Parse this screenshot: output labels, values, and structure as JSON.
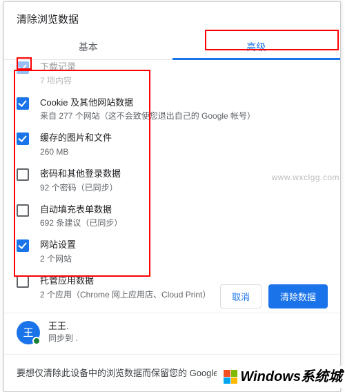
{
  "dialog": {
    "title": "清除浏览数据"
  },
  "tabs": {
    "basic": "基本",
    "advanced": "高级"
  },
  "topItem": {
    "title": "下载记录",
    "sub": "7 项内容"
  },
  "items": [
    {
      "checked": true,
      "title": "Cookie 及其他网站数据",
      "sub": "来自 277 个网站（这不会致使您退出自己的 Google 帐号）"
    },
    {
      "checked": true,
      "title": "缓存的图片和文件",
      "sub": "260 MB"
    },
    {
      "checked": false,
      "title": "密码和其他登录数据",
      "sub": "92 个密码（已同步）"
    },
    {
      "checked": false,
      "title": "自动填充表单数据",
      "sub": "692 条建议（已同步）"
    },
    {
      "checked": true,
      "title": "网站设置",
      "sub": "2 个网站"
    },
    {
      "checked": false,
      "title": "托管应用数据",
      "sub": "2 个应用（Chrome 网上应用店、Cloud Print）"
    }
  ],
  "actions": {
    "cancel": "取消",
    "clear": "清除数据"
  },
  "user": {
    "avatarLetter": "王",
    "name": "王王.",
    "sync": "同步到 ."
  },
  "footerNote": "要想仅清除此设备中的浏览数据而保留您的 Google 帐",
  "watermark": {
    "big": "Windows系统城",
    "small": "www.wxclgg.com"
  }
}
